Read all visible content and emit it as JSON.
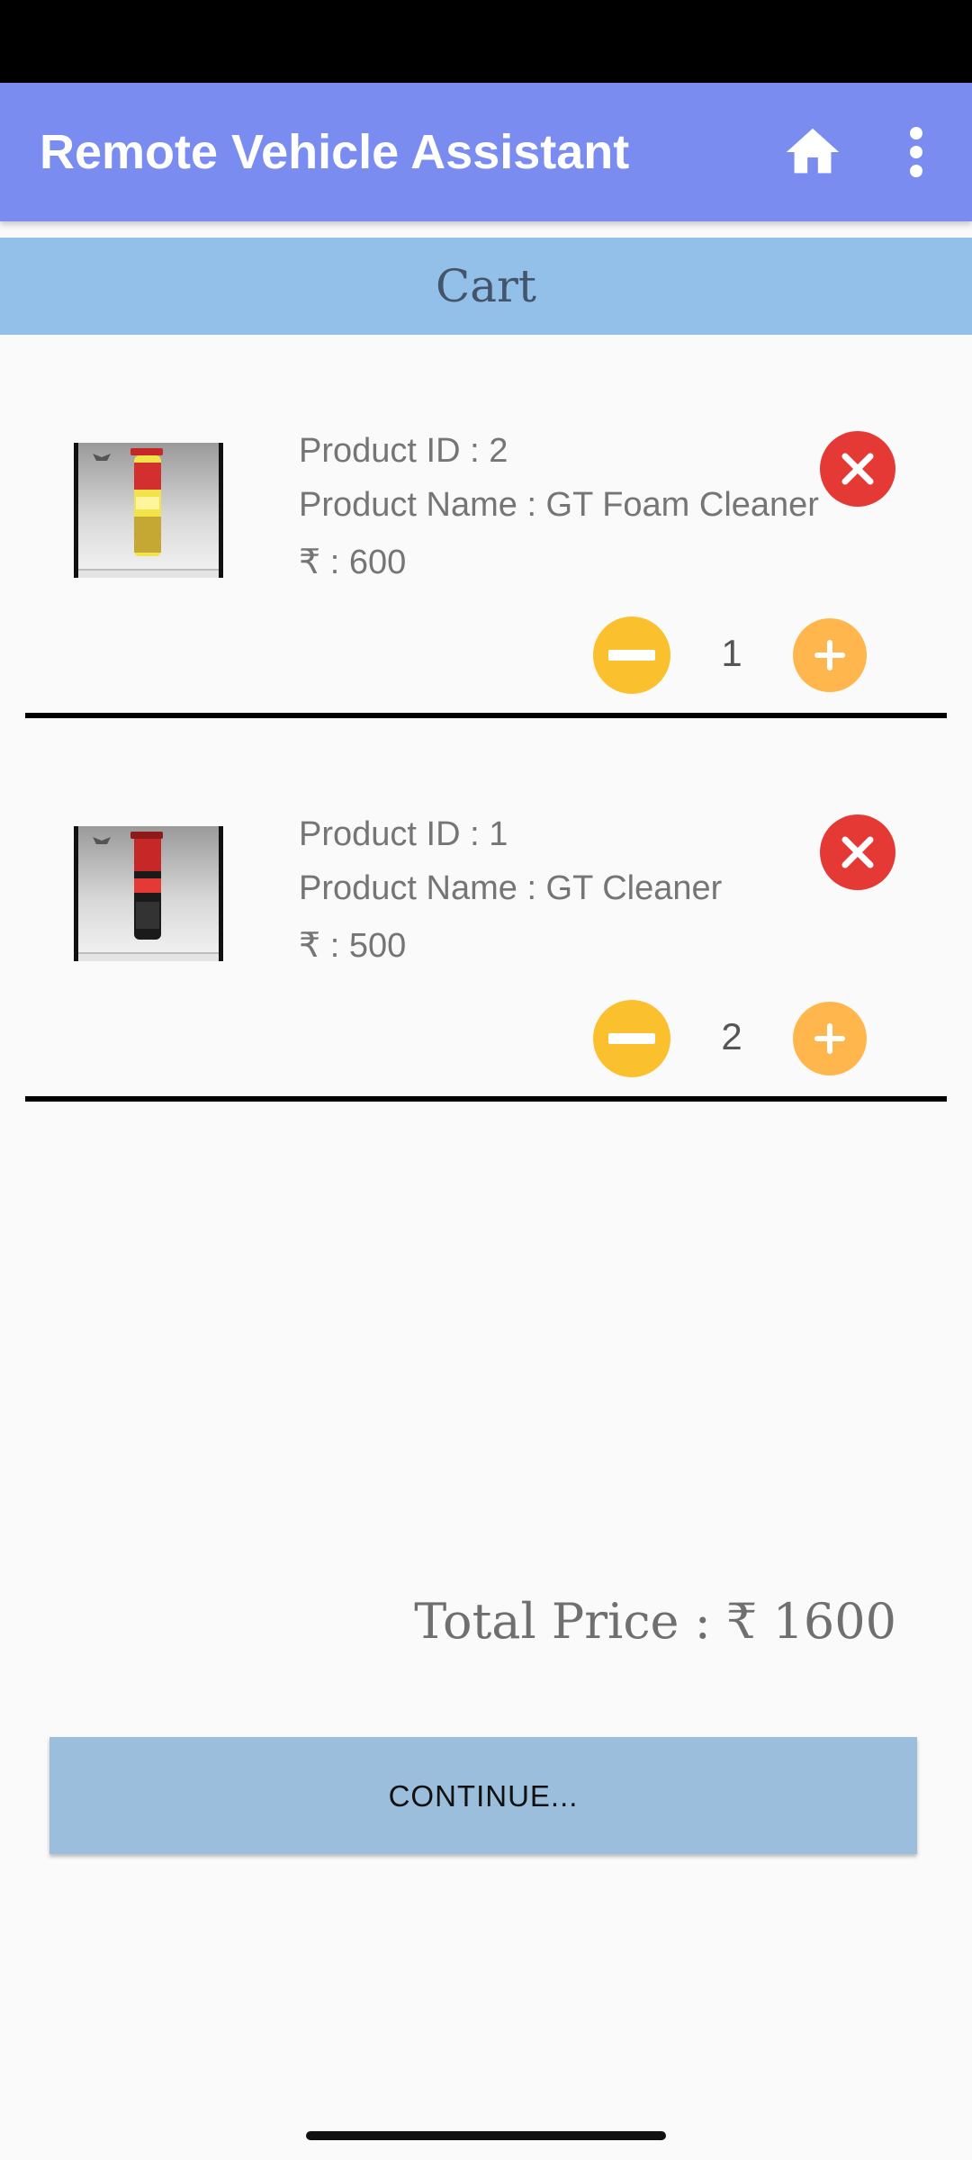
{
  "app_bar": {
    "title": "Remote Vehicle Assistant",
    "home_icon": "home-icon",
    "menu_icon": "more-vert-icon",
    "color": "#7a8cef"
  },
  "header": {
    "title": "Cart",
    "color": "#93c0e8"
  },
  "cart": {
    "items": [
      {
        "id_text": "Product ID : 2",
        "name_text": "Product Name : GT Foam Cleaner",
        "price_text": "₹ : 600",
        "quantity": "1",
        "image": "foam-cleaner-can-image"
      },
      {
        "id_text": "Product ID : 1",
        "name_text": "Product Name : GT Cleaner",
        "price_text": "₹ : 500",
        "quantity": "2",
        "image": "cleaner-can-image"
      }
    ],
    "remove_icon": "close-circle-icon",
    "minus_icon": "minus-circle-icon",
    "plus_icon": "plus-circle-icon",
    "remove_color": "#e53935",
    "minus_color": "#fbc02d",
    "plus_color": "#ffb74d"
  },
  "summary": {
    "total_text": "Total Price : ₹ 1600"
  },
  "actions": {
    "continue_label": "CONTINUE...",
    "continue_color": "#9abedb"
  }
}
